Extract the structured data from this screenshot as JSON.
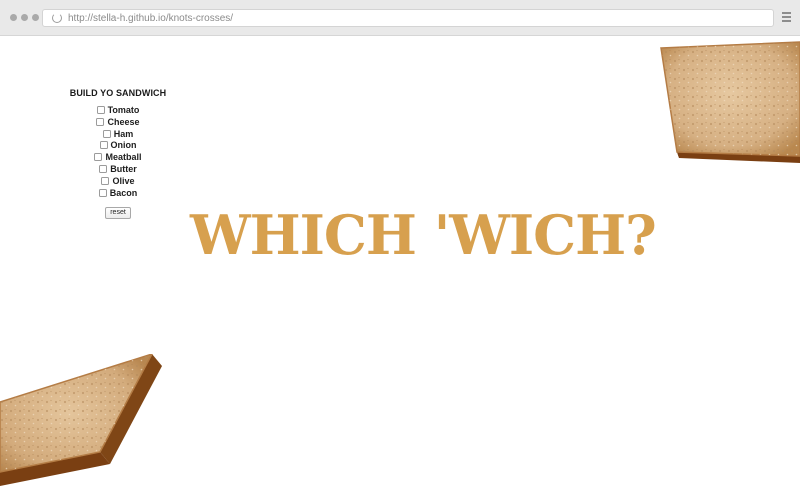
{
  "browser": {
    "url": "http://stella-h.github.io/knots-crosses/"
  },
  "panel": {
    "title": "BUILD YO SANDWICH",
    "options": [
      "Tomato",
      "Cheese",
      "Ham",
      "Onion",
      "Meatball",
      "Butter",
      "Olive",
      "Bacon"
    ],
    "reset_label": "reset"
  },
  "headline": "WHICH 'WICH?",
  "colors": {
    "headline": "#d7a04e",
    "crust": "#8a4f1c",
    "crumb": "#d9b58a"
  }
}
